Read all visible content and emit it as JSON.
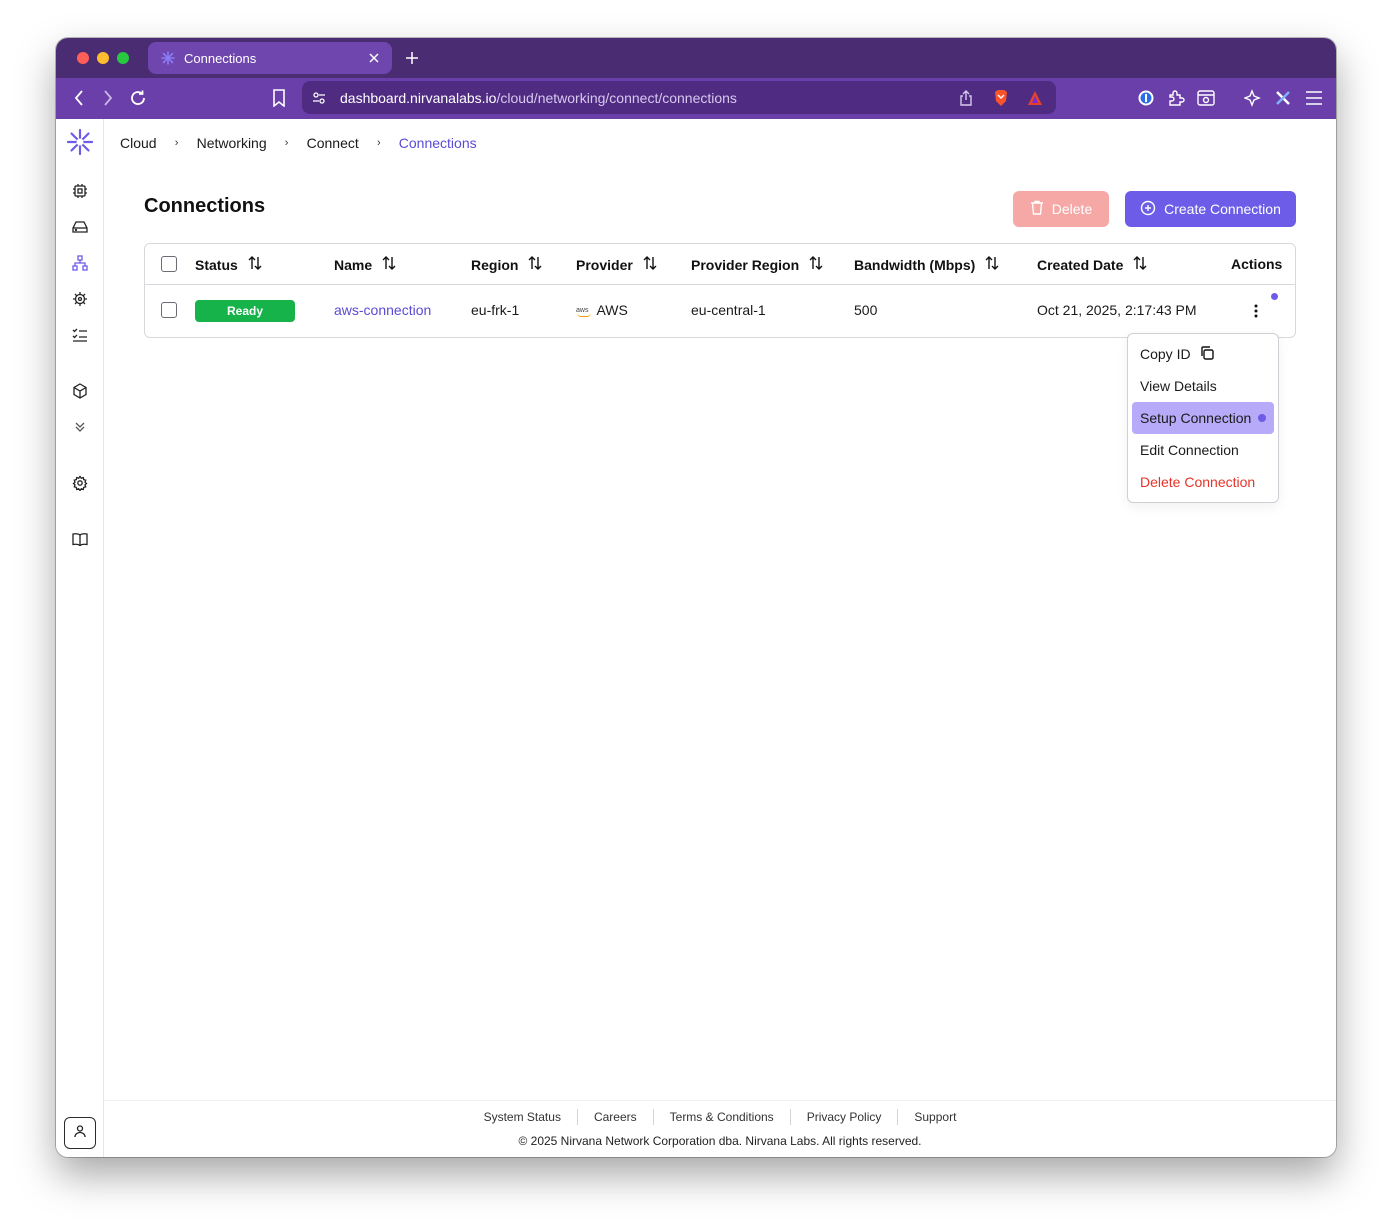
{
  "browser": {
    "tab_title": "Connections",
    "url_host": "dashboard.nirvanalabs.io",
    "url_path": "/cloud/networking/connect/connections"
  },
  "sidebar": {
    "icons": [
      "nirvana-logo-icon",
      "chip-icon",
      "drive-icon",
      "network-icon",
      "helm-icon",
      "checklist-icon",
      "package-icon",
      "chevrons-down-icon",
      "settings-icon",
      "book-icon",
      "user-icon"
    ],
    "active": "network-icon"
  },
  "breadcrumb": [
    "Cloud",
    "Networking",
    "Connect",
    "Connections"
  ],
  "page": {
    "title": "Connections",
    "delete_label": "Delete",
    "create_label": "Create Connection"
  },
  "table": {
    "headers": [
      "Status",
      "Name",
      "Region",
      "Provider",
      "Provider Region",
      "Bandwidth (Mbps)",
      "Created Date",
      "Actions"
    ],
    "rows": [
      {
        "status": "Ready",
        "name": "aws-connection",
        "region": "eu-frk-1",
        "provider_logo": "aws",
        "provider": "AWS",
        "provider_region": "eu-central-1",
        "bandwidth": "500",
        "created": "Oct 21, 2025, 2:17:43 PM"
      }
    ]
  },
  "menu": {
    "items": [
      "Copy ID",
      "View Details",
      "Setup Connection",
      "Edit Connection",
      "Delete Connection"
    ]
  },
  "footer": {
    "links": [
      "System Status",
      "Careers",
      "Terms & Conditions",
      "Privacy Policy",
      "Support"
    ],
    "copyright": "© 2025 Nirvana Network Corporation dba. Nirvana Labs. All rights reserved."
  },
  "colors": {
    "accent": "#6c5ce7",
    "status_ready": "#16b34a",
    "danger": "#e5342a",
    "chrome": "#6b3fa9"
  }
}
